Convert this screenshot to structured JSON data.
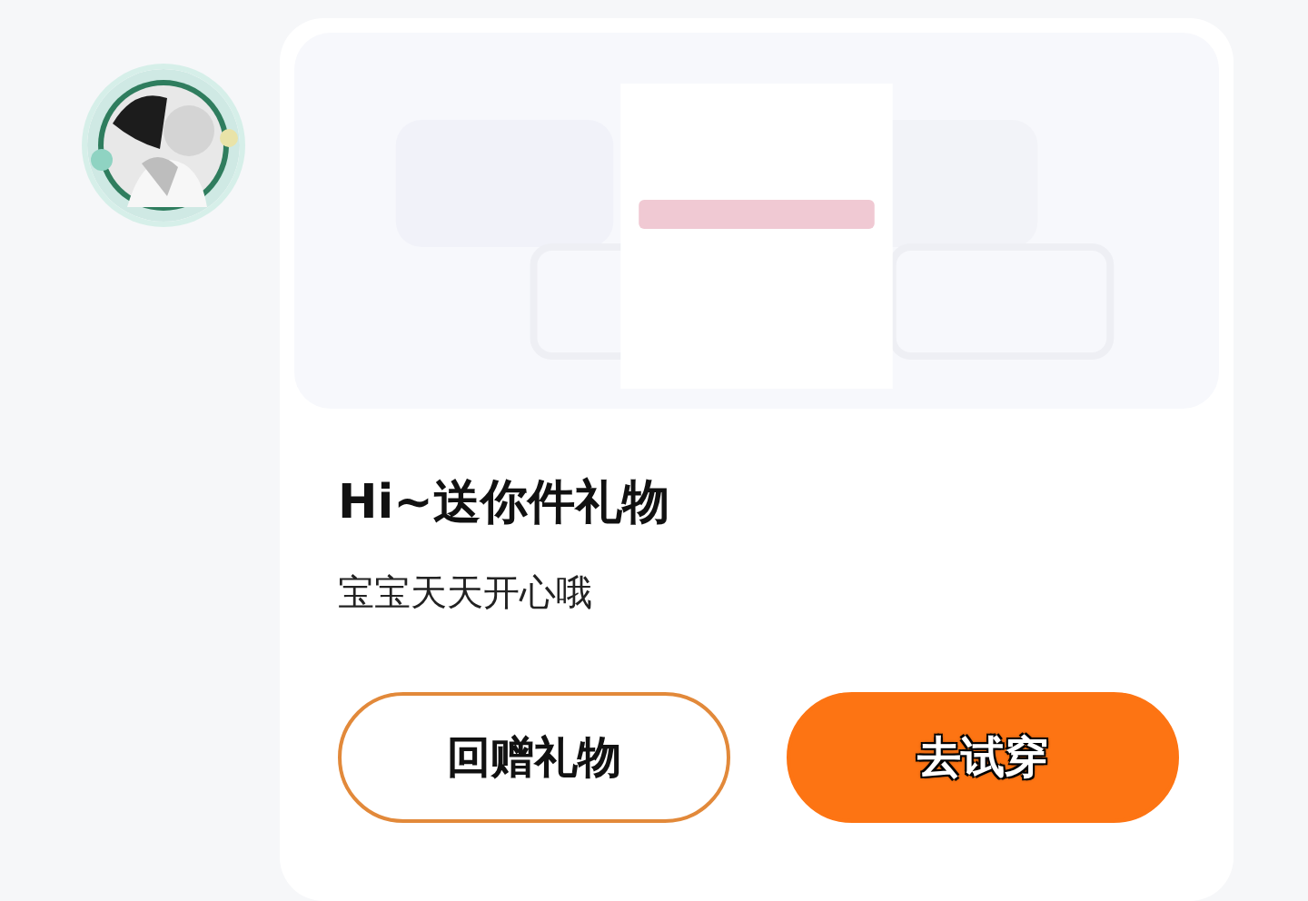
{
  "gift_card": {
    "title": "Hi~送你件礼物",
    "message": "宝宝天天开心哦",
    "buttons": [
      {
        "label": "回赠礼物",
        "kind": "outline"
      },
      {
        "label": "去试穿",
        "kind": "filled"
      }
    ]
  }
}
